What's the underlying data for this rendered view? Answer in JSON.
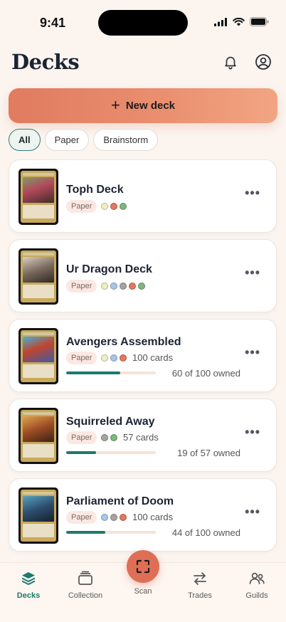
{
  "status": {
    "time": "9:41"
  },
  "header": {
    "title": "Decks"
  },
  "new_deck": {
    "label": "New deck"
  },
  "filters": [
    "All",
    "Paper",
    "Brainstorm"
  ],
  "colors": {
    "pip_white": "#f0efc4",
    "pip_blue": "#a8c6e6",
    "pip_black": "#a7a3a1",
    "pip_red": "#e2785d",
    "pip_green": "#7fb57f",
    "accent": "#1d7a6c",
    "brand": "#df6e57"
  },
  "decks": [
    {
      "name": "Toph Deck",
      "tag": "Paper",
      "pips": [
        "pip_white",
        "pip_red",
        "pip_green"
      ],
      "count": "",
      "owned": "",
      "progress": null
    },
    {
      "name": "Ur Dragon Deck",
      "tag": "Paper",
      "pips": [
        "pip_white",
        "pip_blue",
        "pip_black",
        "pip_red",
        "pip_green"
      ],
      "count": "",
      "owned": "",
      "progress": null
    },
    {
      "name": "Avengers Assembled",
      "tag": "Paper",
      "pips": [
        "pip_white",
        "pip_blue",
        "pip_red"
      ],
      "count": "100 cards",
      "owned": "60 of 100 owned",
      "progress": 0.6
    },
    {
      "name": "Squirreled Away",
      "tag": "Paper",
      "pips": [
        "pip_black",
        "pip_green"
      ],
      "count": "57 cards",
      "owned": "19 of 57 owned",
      "progress": 0.333
    },
    {
      "name": "Parliament of Doom",
      "tag": "Paper",
      "pips": [
        "pip_blue",
        "pip_black",
        "pip_red"
      ],
      "count": "100 cards",
      "owned": "44 of 100 owned",
      "progress": 0.44
    }
  ],
  "tabs": {
    "decks": "Decks",
    "collection": "Collection",
    "scan": "Scan",
    "trades": "Trades",
    "guilds": "Guilds"
  }
}
